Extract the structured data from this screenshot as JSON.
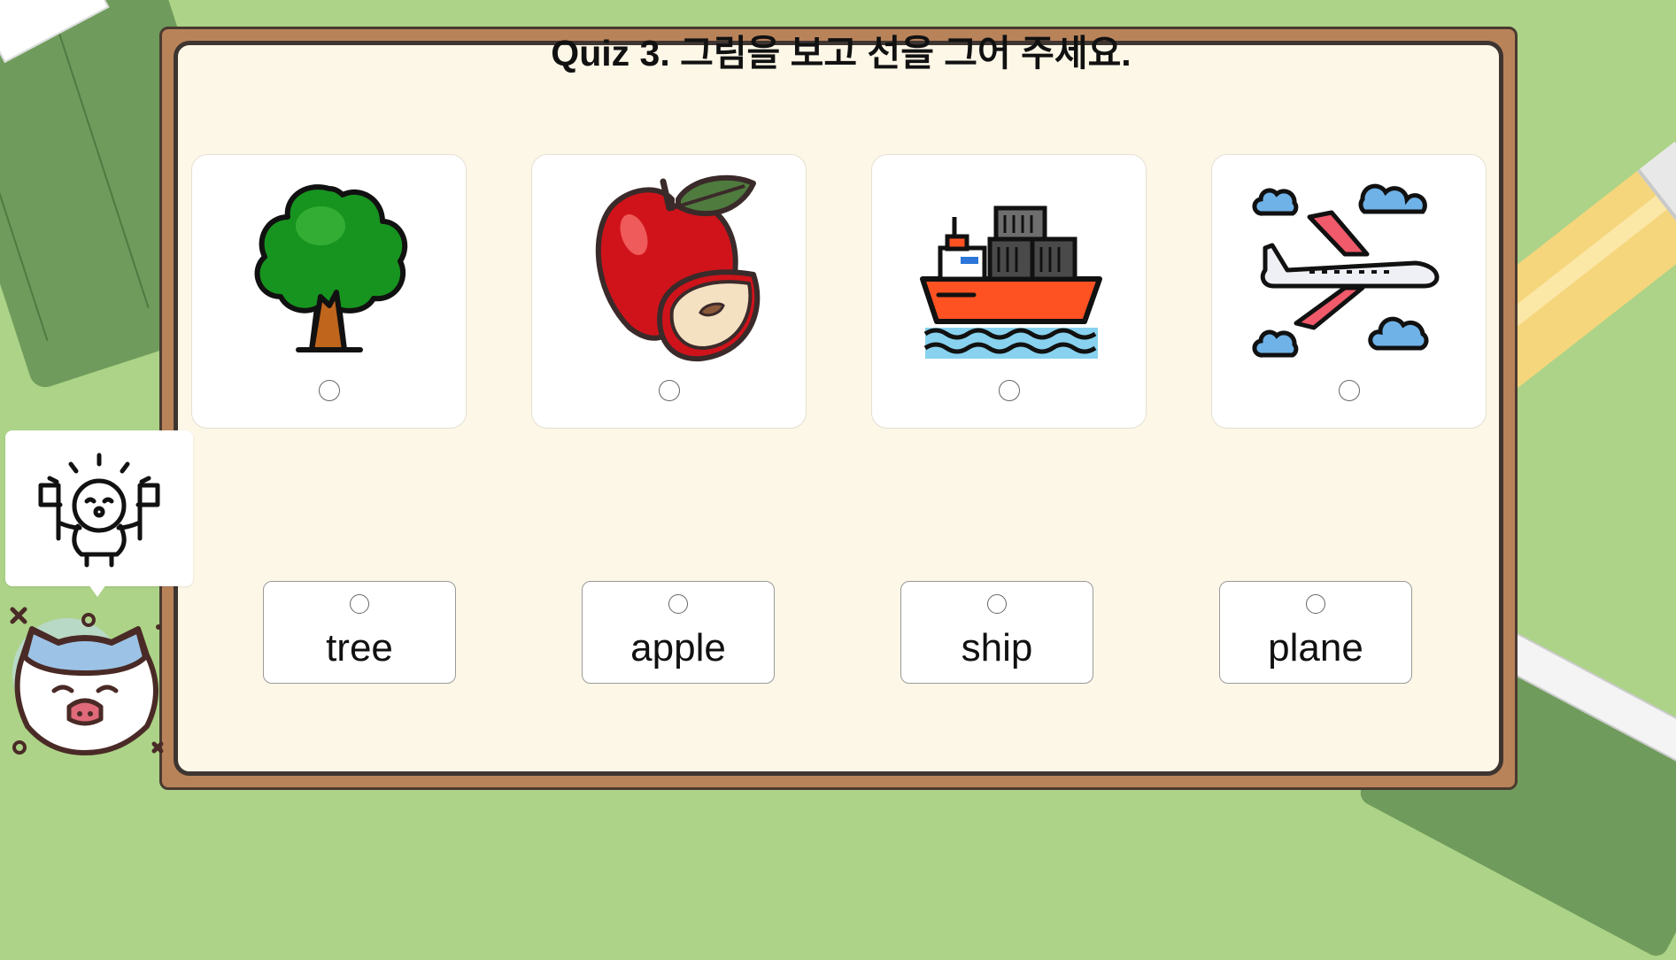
{
  "quiz": {
    "title": "Quiz 3. 그림을 보고 선을 그어 주세요."
  },
  "pictures": [
    {
      "icon": "tree-icon"
    },
    {
      "icon": "apple-icon"
    },
    {
      "icon": "ship-icon"
    },
    {
      "icon": "airplane-icon"
    }
  ],
  "words": [
    {
      "label": "tree"
    },
    {
      "label": "apple"
    },
    {
      "label": "ship"
    },
    {
      "label": "plane"
    }
  ],
  "colors": {
    "background": "#acd387",
    "board_frame": "#b9835a",
    "board_paper": "#fdf7e7"
  }
}
